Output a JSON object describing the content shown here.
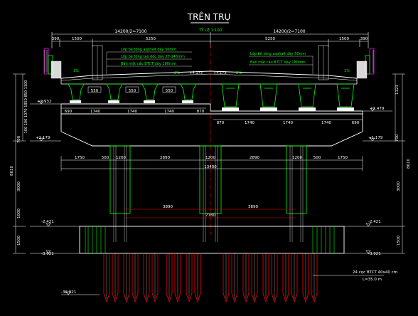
{
  "title": "TRÊN TRỤ",
  "scale": "TỶ LỆ 1:100",
  "dims": {
    "half_left": "14200/2=7100",
    "half_right": "14200/2=7100",
    "top_390_l": "390",
    "top_1500_l": "1500",
    "top_5250_l": "5250",
    "top_5250_r": "5250",
    "top_1500_r": "1500",
    "top_390_r": "390",
    "g550_1": "550",
    "g550_2": "550",
    "g550_3": "550",
    "b690_l": "690",
    "b1740_1": "1740",
    "b1740_2": "1740",
    "b1740_3": "1740",
    "b870_l": "870",
    "b870_r": "870",
    "b1740_4": "1740",
    "b1740_5": "1740",
    "b1740_6": "1740",
    "b690_r": "690",
    "c1750_l": "1750",
    "c500_l": "500",
    "c1200_l": "1200",
    "c2890_l": "2890",
    "c1200_m": "1200",
    "c2890_r": "2890",
    "c1200_r": "1200",
    "c500_r": "500",
    "c1750_r": "1750",
    "total_13400": "13400",
    "f3890_l": "3890",
    "f3890_r": "3890",
    "f7780": "7780",
    "v700_top": "700",
    "v8610": "8610",
    "v3000": "3000",
    "v1000_a": "1000",
    "v1500": "1500",
    "right_1123": "1123",
    "right_700": "700",
    "right_8610": "8610",
    "right_3000": "3000",
    "right_1500": "1500"
  },
  "left_col_dims": "100 100 1070 1850 850 1100",
  "elevations": {
    "e2932": "+2.932",
    "e2479": "+2.479",
    "e1179_l": "+1.179",
    "e1179_r": "+1.179",
    "e2421_l": "-2.421",
    "e2421_r": "-2.421",
    "e3921_l": "-3.921",
    "e3921_r": "-3.921",
    "e36921": "-36.921",
    "e4173_l": "+4.173",
    "e4173_r": "+4.173"
  },
  "notes_left": [
    "Lớp bê tông asphalt dày 50mm",
    "Lớp bê tông tạo dốc dày 37-145mm",
    "Bản mặt cầu BTCT dày 180mm"
  ],
  "notes_right": [
    "Lớp bê tông asphalt dày 50mm",
    "Bản mặt cầu BTCT dày 180mm"
  ],
  "small_labels": {
    "drain_l": "1%",
    "drain_r": "1%",
    "sign_l": "2%",
    "sign_r": "2%"
  },
  "pile_note_1": "24 cọc BTCT 40x40 cm",
  "pile_note_2": "L=35.0 m",
  "colors": {
    "background": "#000000",
    "white": "#ffffff",
    "green": "#00ff00",
    "yellow": "#ffff00",
    "cyan": "#00ffff",
    "red": "#ff0000",
    "magenta": "#ff00ff"
  }
}
